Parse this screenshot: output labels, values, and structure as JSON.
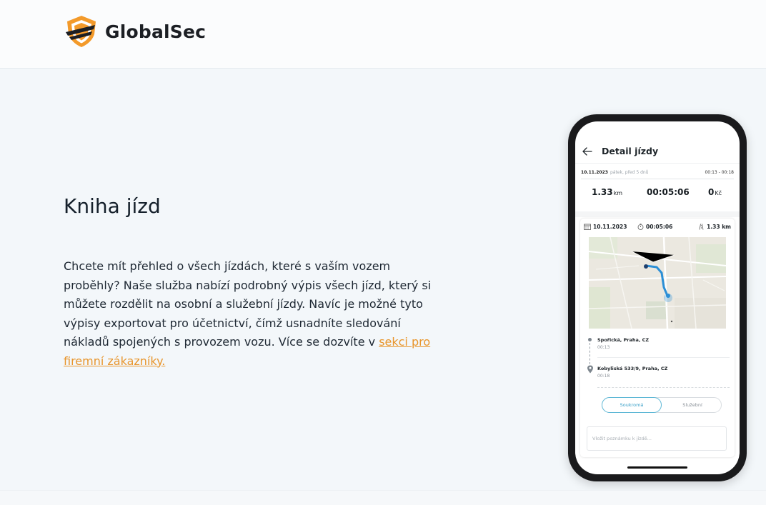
{
  "brand": {
    "name": "GlobalSec",
    "colors": {
      "orange": "#f39a2b",
      "dark": "#1c1f24",
      "link": "#e8952b"
    }
  },
  "section": {
    "title": "Kniha jízd",
    "paragraph": "Chcete mít přehled o všech jízdách, které s vaším vozem proběhly? Naše služba nabízí podrobný výpis všech jízd, který si můžete rozdělit na osobní a služební jízdy. Navíc je možné tyto výpisy exportovat pro účetnictví, čímž usnadníte sledování nákladů spojených s provozem vozu. Více se dozvíte v ",
    "link_text": "sekci pro firemní zákazníky.",
    "link_suffix": ""
  },
  "phone": {
    "screen_title": "Detail jízdy",
    "date": "10.11.2023",
    "date_sub": "pátek, před 5 dnů",
    "time_range": "00:13 - 00:18",
    "stats": {
      "distance": "1.33",
      "distance_unit": "km",
      "duration": "00:05:06",
      "cost": "0",
      "cost_unit": "Kč"
    },
    "card": {
      "date": "10.11.2023",
      "duration": "00:05:06",
      "distance": "1.33 km",
      "start_address": "Spořická, Praha, CZ",
      "start_time": "00:13",
      "end_address": "Kobyliská 533/9, Praha, CZ",
      "end_time": "00:18",
      "toggle_private": "Soukromá",
      "toggle_business": "Služební",
      "note_placeholder": "Vložit poznámku k jízdě..."
    }
  }
}
